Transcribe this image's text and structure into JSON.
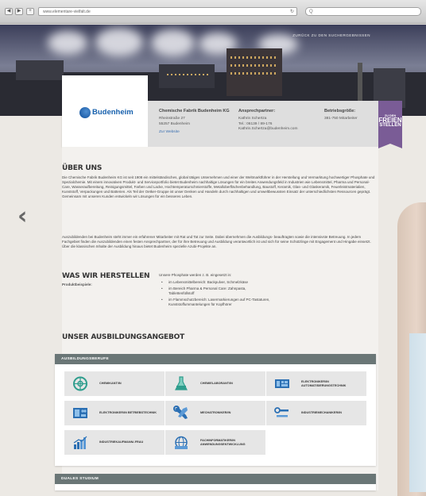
{
  "browser": {
    "url": "www.elementare-vielfalt.de",
    "back_glyph": "◀",
    "forward_glyph": "▶",
    "add_glyph": "+",
    "reload_glyph": "↻",
    "search_glyph": "Q"
  },
  "hero": {
    "link_text": "ZURÜCK ZU DEN SUCHERGEBNISSEN"
  },
  "company": {
    "logo_text": "Budenheim",
    "name": "Chemische Fabrik Budenheim KG",
    "address_line1": "Rheinstraße 27",
    "address_line2": "55257 Budenheim",
    "website_link": "Zur Website",
    "contact_heading": "Ansprechpartner:",
    "contact_name": "Kathrin Schertza",
    "contact_phone": "Tel.: 06139 / 89-176",
    "contact_email": "Kathrin.Schertza@budenheim.com",
    "size_heading": "Betriebsgröße:",
    "size_value": "381-750 Mitarbeiter"
  },
  "ribbon": {
    "line1": "ZU DEN",
    "line2": "FREIEN",
    "line3": "STELLEN"
  },
  "about": {
    "title": "ÜBER UNS",
    "paragraph1": "Die Chemische Fabrik Budenheim KG ist seit 1908 ein mittelständisches, global tätiges Unternehmen und einer der Weltmarktführer in der Herstellung und Vermarktung hochwertiger Phosphate und Spezialchemie. Mit einem innovativen Produkt- und Serviceportfolio bietet Budenheim nachhaltige Lösungen für ein breites Anwendungsfeld in Industrien wie Lebensmittel, Pharma und Personal-Care, Wasseraufbereitung, Reinigungsmittel, Farben und Lacke, Hochtemperaturschmierstoffe, Metalloberflächenbehandlung, Baustoff, Keramik, Glas- und Glaskeramik, Feuerleistmaterialien, Kunststoff, Verpackungen und Batterien. Als Teil der Oetker-Gruppe ist unser Denken und Handeln durch nachhaltigen und umweltbewussten Einsatz der unterschiedlichsten Ressourcen geprägt. Gemeinsam mit unseren Kunden entwickeln wir Lösungen für ein besseres Leben.",
    "paragraph2": "Auszubildenden bei Budenheim steht immer ein erfahrener Mitarbeiter mit Rat und Tat zur Seite. Dabei übernehmen die Ausbildungs- beauftragten sowie die intensivste Betreuung. In jedem Fachgebiet finden die Auszubildenden einen festen Ansprechpartner, der für ihre Betreuung und Ausbildung verantwortlich ist und sich für seine Schützlinge mit Engagement und Hingabe einsetzt. Über die klassischen Inhalte der Ausbildung hinaus bietet Budenheim spezielle Azubi-Projekte an."
  },
  "products": {
    "title": "WAS WIR HERSTELLEN",
    "sublabel": "Produktbeispiele:",
    "intro": "Unsere Phosphate werden z. B. eingesetzt in:",
    "items": [
      "im Lebensmittelbereich: Backpulver, Schmelzkäse",
      "im Bereich Pharma & Personal Care: Zahnpasta, Tablettenfüllstoff",
      "im Flammschutzbereich: Lasermarkierungen auf PC-Tastaturen, Kunststoffummantelungen für Kopfhörer"
    ]
  },
  "training": {
    "title": "UNSER AUSBILDUNGSANGEBOT",
    "panel_title": "AUSBILDUNGSBERUFE",
    "tiles": [
      {
        "label": "CHEMIKANT/IN",
        "icon": "flask-circle-icon"
      },
      {
        "label": "CHEMIELABORANT/IN",
        "icon": "flask-icon"
      },
      {
        "label": "ELEKTRONIKER/IN AUTOMATISIERUNGSTECHNIK",
        "icon": "circuit-board-icon"
      },
      {
        "label": "ELEKTRONIKER/IN BETRIEBSTECHNIK",
        "icon": "control-panel-icon"
      },
      {
        "label": "MECHATRONIKER/IN",
        "icon": "wrench-icon"
      },
      {
        "label": "INDUSTRIEMECHANIKER/IN",
        "icon": "screwdriver-icon"
      },
      {
        "label": "INDUSTRIEKAUFMANN/-FRAU",
        "icon": "bar-chart-icon"
      },
      {
        "label": "FACHINFORMATIKER/IN ANWENDUNGSENTWICKLUNG",
        "icon": "globe-network-icon"
      }
    ],
    "dual_panel_title": "DUALES STUDIUM"
  },
  "colors": {
    "accent_purple": "#7a5c96",
    "panel_header": "#6a7676",
    "icon_teal": "#2e9d8d",
    "icon_blue": "#2b6fb3",
    "link_blue": "#3a6fb0"
  }
}
